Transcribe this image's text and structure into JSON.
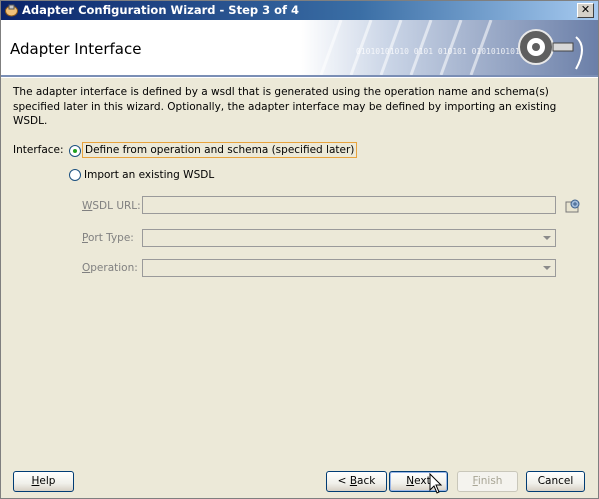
{
  "window": {
    "title": "Adapter Configuration Wizard - Step 3 of 4",
    "close_glyph": "✕"
  },
  "header": {
    "title": "Adapter Interface",
    "banner_art_text": "01010101010 0101 010101 0101010101"
  },
  "description": "The adapter interface is defined by a wsdl that is generated using the operation name and schema(s) specified later in this wizard.  Optionally, the adapter interface may be defined by importing an existing WSDL.",
  "interface": {
    "label": "Interface:",
    "options": [
      {
        "label": "Define from operation and schema (specified later)",
        "selected": true
      },
      {
        "label": "Import an existing WSDL",
        "selected": false
      }
    ]
  },
  "fields": {
    "wsdl_url": {
      "label_first": "W",
      "label_rest": "SDL URL:",
      "value": ""
    },
    "port_type": {
      "label_first": "P",
      "label_rest": "ort Type:",
      "value": ""
    },
    "operation": {
      "label_first": "O",
      "label_rest": "peration:",
      "value": ""
    }
  },
  "buttons": {
    "help": {
      "first": "H",
      "rest": "elp"
    },
    "back": {
      "pre": "< ",
      "first": "B",
      "rest": "ack"
    },
    "next": {
      "first": "N",
      "rest": "ext"
    },
    "finish": {
      "first": "F",
      "rest": "inish"
    },
    "cancel": "Cancel"
  },
  "colors": {
    "title_bar": "#0a246a",
    "selection_border": "#e8a33d",
    "radio_dot": "#21a121"
  },
  "icons": [
    "wizard-app-icon",
    "close-icon",
    "gear-plug-icon",
    "browse-icon",
    "chevron-down-icon",
    "mouse-cursor-icon"
  ]
}
